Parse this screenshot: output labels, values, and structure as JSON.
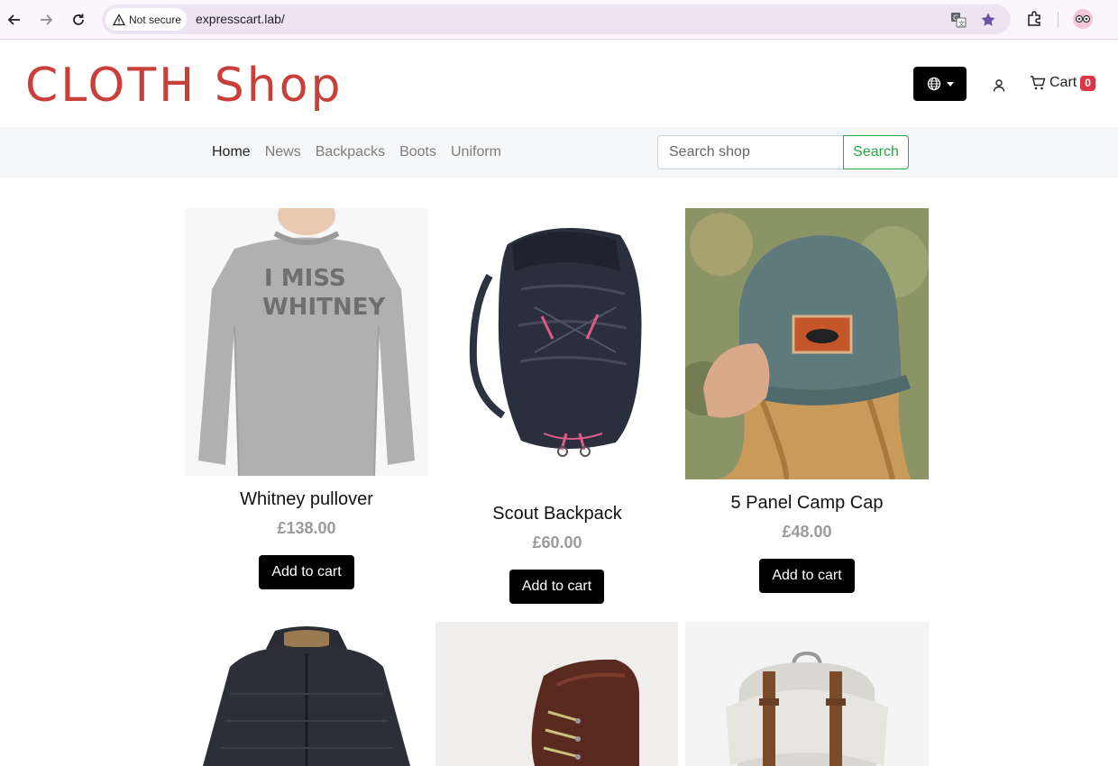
{
  "browser": {
    "security_label": "Not secure",
    "url": "expresscart.lab/"
  },
  "header": {
    "logo": "CLOTH Shop",
    "cart_label": "Cart",
    "cart_count": "0"
  },
  "nav": {
    "links": [
      "Home",
      "News",
      "Backpacks",
      "Boots",
      "Uniform"
    ],
    "active": "Home"
  },
  "search": {
    "placeholder": "Search shop",
    "button_label": "Search"
  },
  "products": [
    {
      "title": "Whitney pullover",
      "price": "£138.00",
      "button": "Add to cart",
      "image_text": "I MISS WHITNEY"
    },
    {
      "title": "Scout Backpack",
      "price": "£60.00",
      "button": "Add to cart"
    },
    {
      "title": "5 Panel Camp Cap",
      "price": "£48.00",
      "button": "Add to cart"
    },
    {
      "title": "",
      "price": "",
      "button": ""
    },
    {
      "title": "",
      "price": "",
      "button": ""
    },
    {
      "title": "",
      "price": "",
      "button": ""
    }
  ],
  "colors": {
    "logo": "#c9403a",
    "search_accent": "#28a745",
    "badge": "#dc3545",
    "button": "#000000",
    "price": "#9a9a9a"
  }
}
